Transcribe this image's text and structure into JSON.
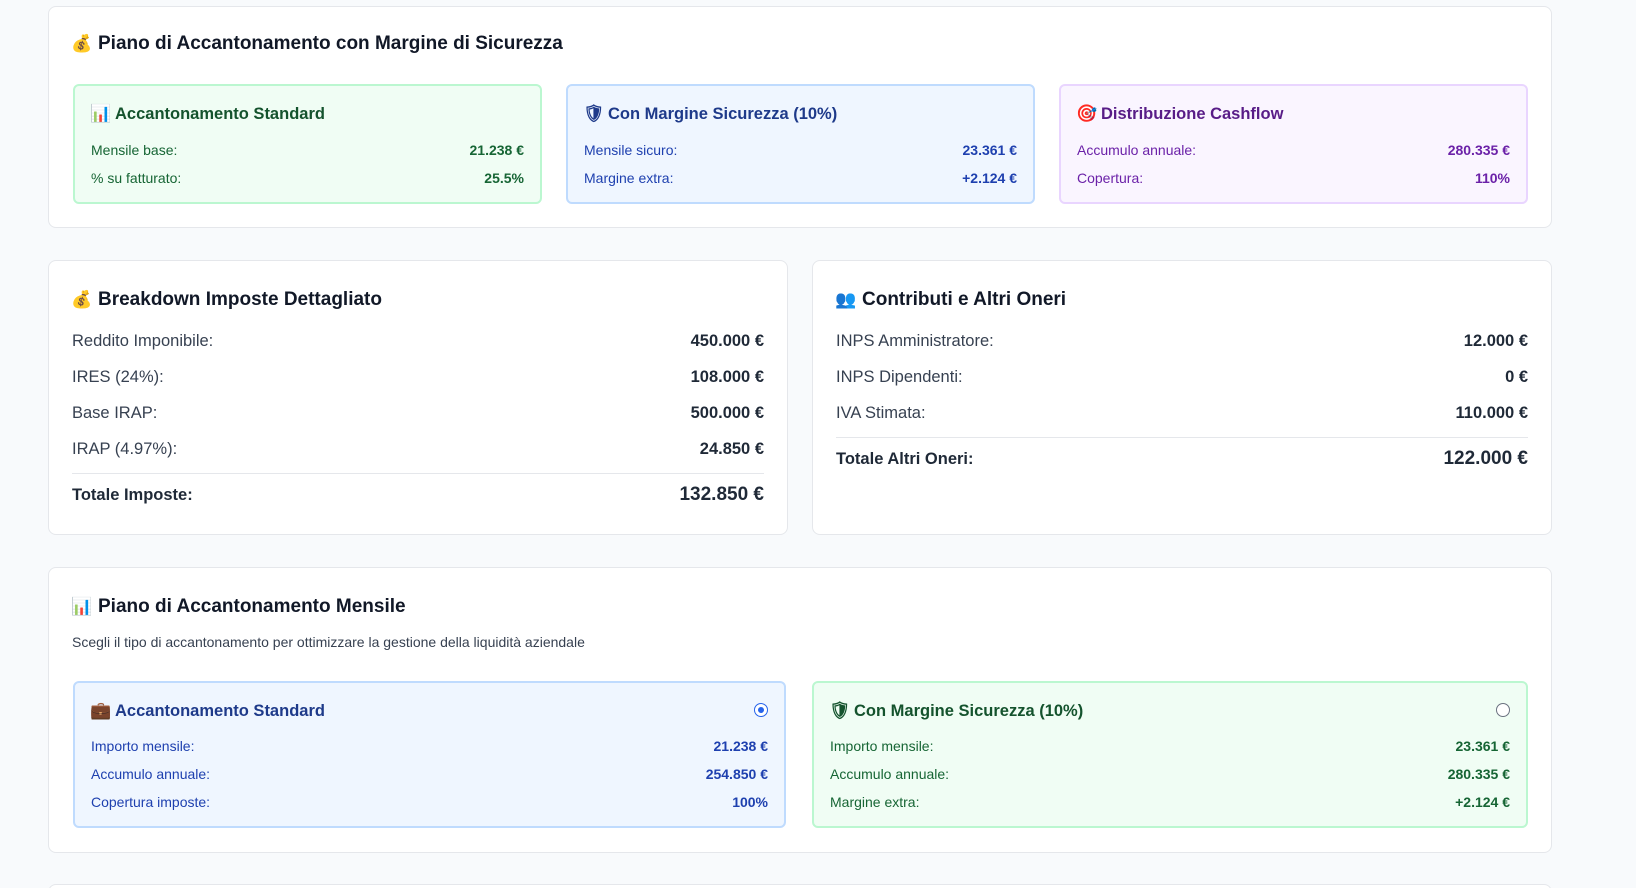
{
  "savings_plan_margin": {
    "icon": "💰",
    "title": "Piano di Accantonamento con Margine di Sicurezza",
    "standard": {
      "icon": "📊",
      "title": "Accantonamento Standard",
      "rows": [
        {
          "label": "Mensile base:",
          "value": "21.238 €"
        },
        {
          "label": "% su fatturato:",
          "value": "25.5%"
        }
      ]
    },
    "safety": {
      "icon": "🛡",
      "title": "Con Margine Sicurezza (10%)",
      "rows": [
        {
          "label": "Mensile sicuro:",
          "value": "23.361 €"
        },
        {
          "label": "Margine extra:",
          "value": "+2.124 €"
        }
      ]
    },
    "cashflow": {
      "icon": "🎯",
      "title": "Distribuzione Cashflow",
      "rows": [
        {
          "label": "Accumulo annuale:",
          "value": "280.335 €"
        },
        {
          "label": "Copertura:",
          "value": "110%"
        }
      ]
    }
  },
  "taxes": {
    "icon": "💰",
    "title": "Breakdown Imposte Dettagliato",
    "rows": [
      {
        "label": "Reddito Imponibile:",
        "value": "450.000 €"
      },
      {
        "label": "IRES (24%):",
        "value": "108.000 €"
      },
      {
        "label": "Base IRAP:",
        "value": "500.000 €"
      },
      {
        "label": "IRAP (4.97%):",
        "value": "24.850 €"
      }
    ],
    "total_label": "Totale Imposte:",
    "total_value": "132.850 €"
  },
  "contributions": {
    "icon": "👥",
    "title": "Contributi e Altri Oneri",
    "rows": [
      {
        "label": "INPS Amministratore:",
        "value": "12.000 €"
      },
      {
        "label": "INPS Dipendenti:",
        "value": "0 €"
      },
      {
        "label": "IVA Stimata:",
        "value": "110.000 €"
      }
    ],
    "total_label": "Totale Altri Oneri:",
    "total_value": "122.000 €"
  },
  "monthly_plan": {
    "icon": "📊",
    "title": "Piano di Accantonamento Mensile",
    "description": "Scegli il tipo di accantonamento per ottimizzare la gestione della liquidità aziendale",
    "standard": {
      "icon": "💼",
      "title": "Accantonamento Standard",
      "selected": true,
      "rows": [
        {
          "label": "Importo mensile:",
          "value": "21.238 €"
        },
        {
          "label": "Accumulo annuale:",
          "value": "254.850 €"
        },
        {
          "label": "Copertura imposte:",
          "value": "100%"
        }
      ]
    },
    "safety": {
      "icon": "🛡",
      "title": "Con Margine Sicurezza (10%)",
      "selected": false,
      "rows": [
        {
          "label": "Importo mensile:",
          "value": "23.361 €"
        },
        {
          "label": "Accumulo annuale:",
          "value": "280.335 €"
        },
        {
          "label": "Margine extra:",
          "value": "+2.124 €"
        }
      ]
    }
  }
}
